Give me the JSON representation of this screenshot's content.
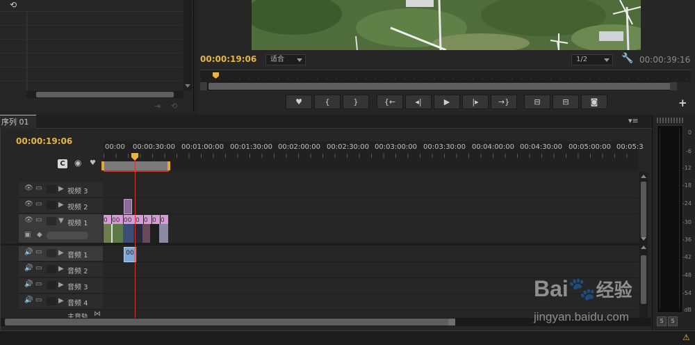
{
  "project_panel": {},
  "monitor": {
    "current_timecode": "00:00:19:06",
    "fit_label": "适合",
    "resolution_label": "1/2",
    "duration_timecode": "00:00:39:16",
    "buttons": [
      "♥",
      "{",
      "}",
      "{←",
      "◂|",
      "▶",
      "|▸",
      "→}",
      "⊟",
      "⊟",
      "◙"
    ]
  },
  "timeline": {
    "tab_label": "序列 01",
    "tab_close": "×",
    "current_timecode": "00:00:19:06",
    "ruler_labels": [
      "00:00",
      "00:00:30:00",
      "00:01:00:00",
      "00:01:30:00",
      "00:02:00:00",
      "00:02:30:00",
      "00:03:00:00",
      "00:03:30:00",
      "00:04:00:00",
      "00:04:30:00",
      "00:05:00:00",
      "00:05:3"
    ],
    "video_tracks": [
      {
        "name": "视频 3"
      },
      {
        "name": "视频 2"
      },
      {
        "name": "视频 1"
      }
    ],
    "audio_tracks": [
      {
        "name": "音频 1"
      },
      {
        "name": "音频 2"
      },
      {
        "name": "音频 3"
      },
      {
        "name": "音频 4"
      }
    ],
    "master_track_label": "主音轨",
    "v1_clip_labels": [
      "0",
      "00",
      "00",
      "0",
      "0",
      "0",
      "0"
    ],
    "a1_clip_label": "00"
  },
  "meter": {
    "db_labels": [
      "0",
      "-6",
      "-12",
      "-18",
      "-24",
      "-30",
      "-36",
      "-42",
      "-48",
      "-54",
      "dB"
    ],
    "solo_labels": [
      "S",
      "S"
    ]
  },
  "watermark": {
    "brand": "Bai",
    "brand_cn": "经验",
    "url": "jingyan.baidu.com"
  },
  "colors": {
    "accent": "#e8b640",
    "playhead": "#d23b2b",
    "clip_pink": "#d99ad9",
    "clip_blue": "#7fa7d6"
  }
}
